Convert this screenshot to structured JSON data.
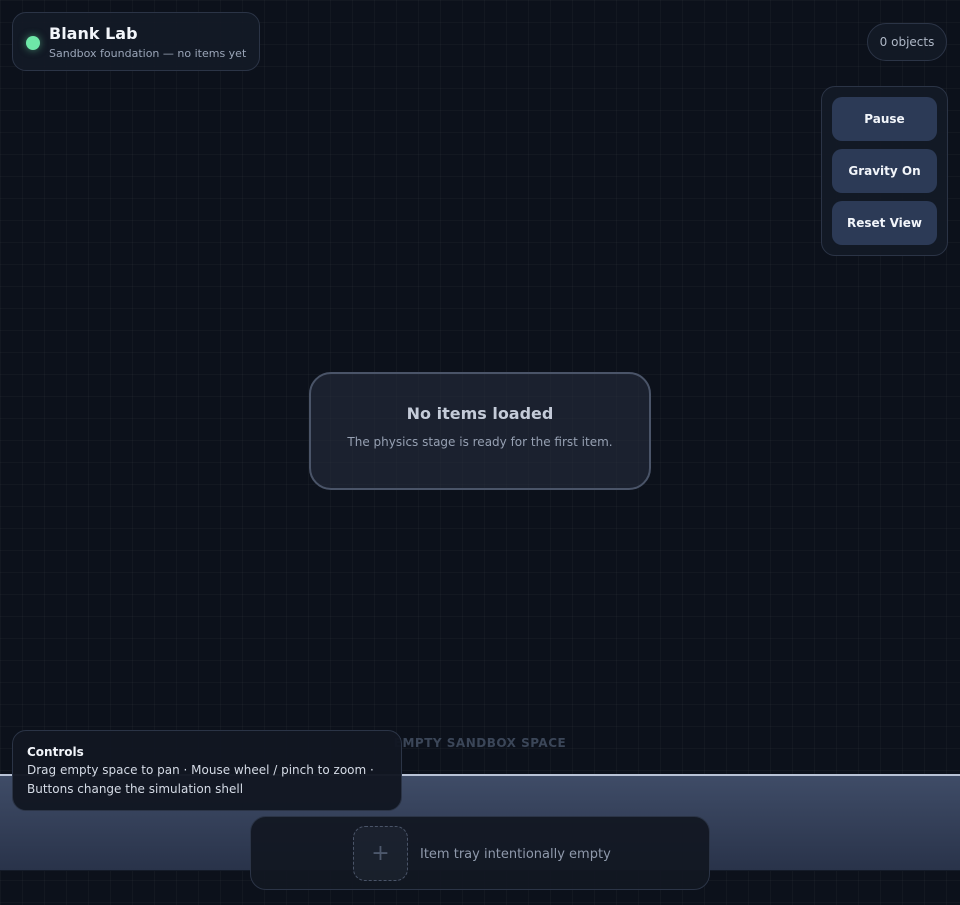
{
  "header": {
    "title": "Blank Lab",
    "subtitle": "Sandbox foundation — no items yet",
    "status_color": "#6ee7a8"
  },
  "object_count": "0 objects",
  "controls": {
    "pause_label": "Pause",
    "gravity_label": "Gravity On",
    "reset_label": "Reset View"
  },
  "empty_state": {
    "title": "No items loaded",
    "description": "The physics stage is ready for the first item."
  },
  "ground": {
    "label": "EMPTY SANDBOX SPACE"
  },
  "help": {
    "title": "Controls",
    "text": "Drag empty space to pan · Mouse wheel / pinch to zoom · Buttons change the simulation shell"
  },
  "tray": {
    "slot_icon": "plus-icon",
    "slot_glyph": "+",
    "label": "Item tray intentionally empty"
  },
  "colors": {
    "background": "#0c111b",
    "button": "#2c3a56",
    "floor": "#3f4c67",
    "floor_edge": "#b9c3d6"
  }
}
